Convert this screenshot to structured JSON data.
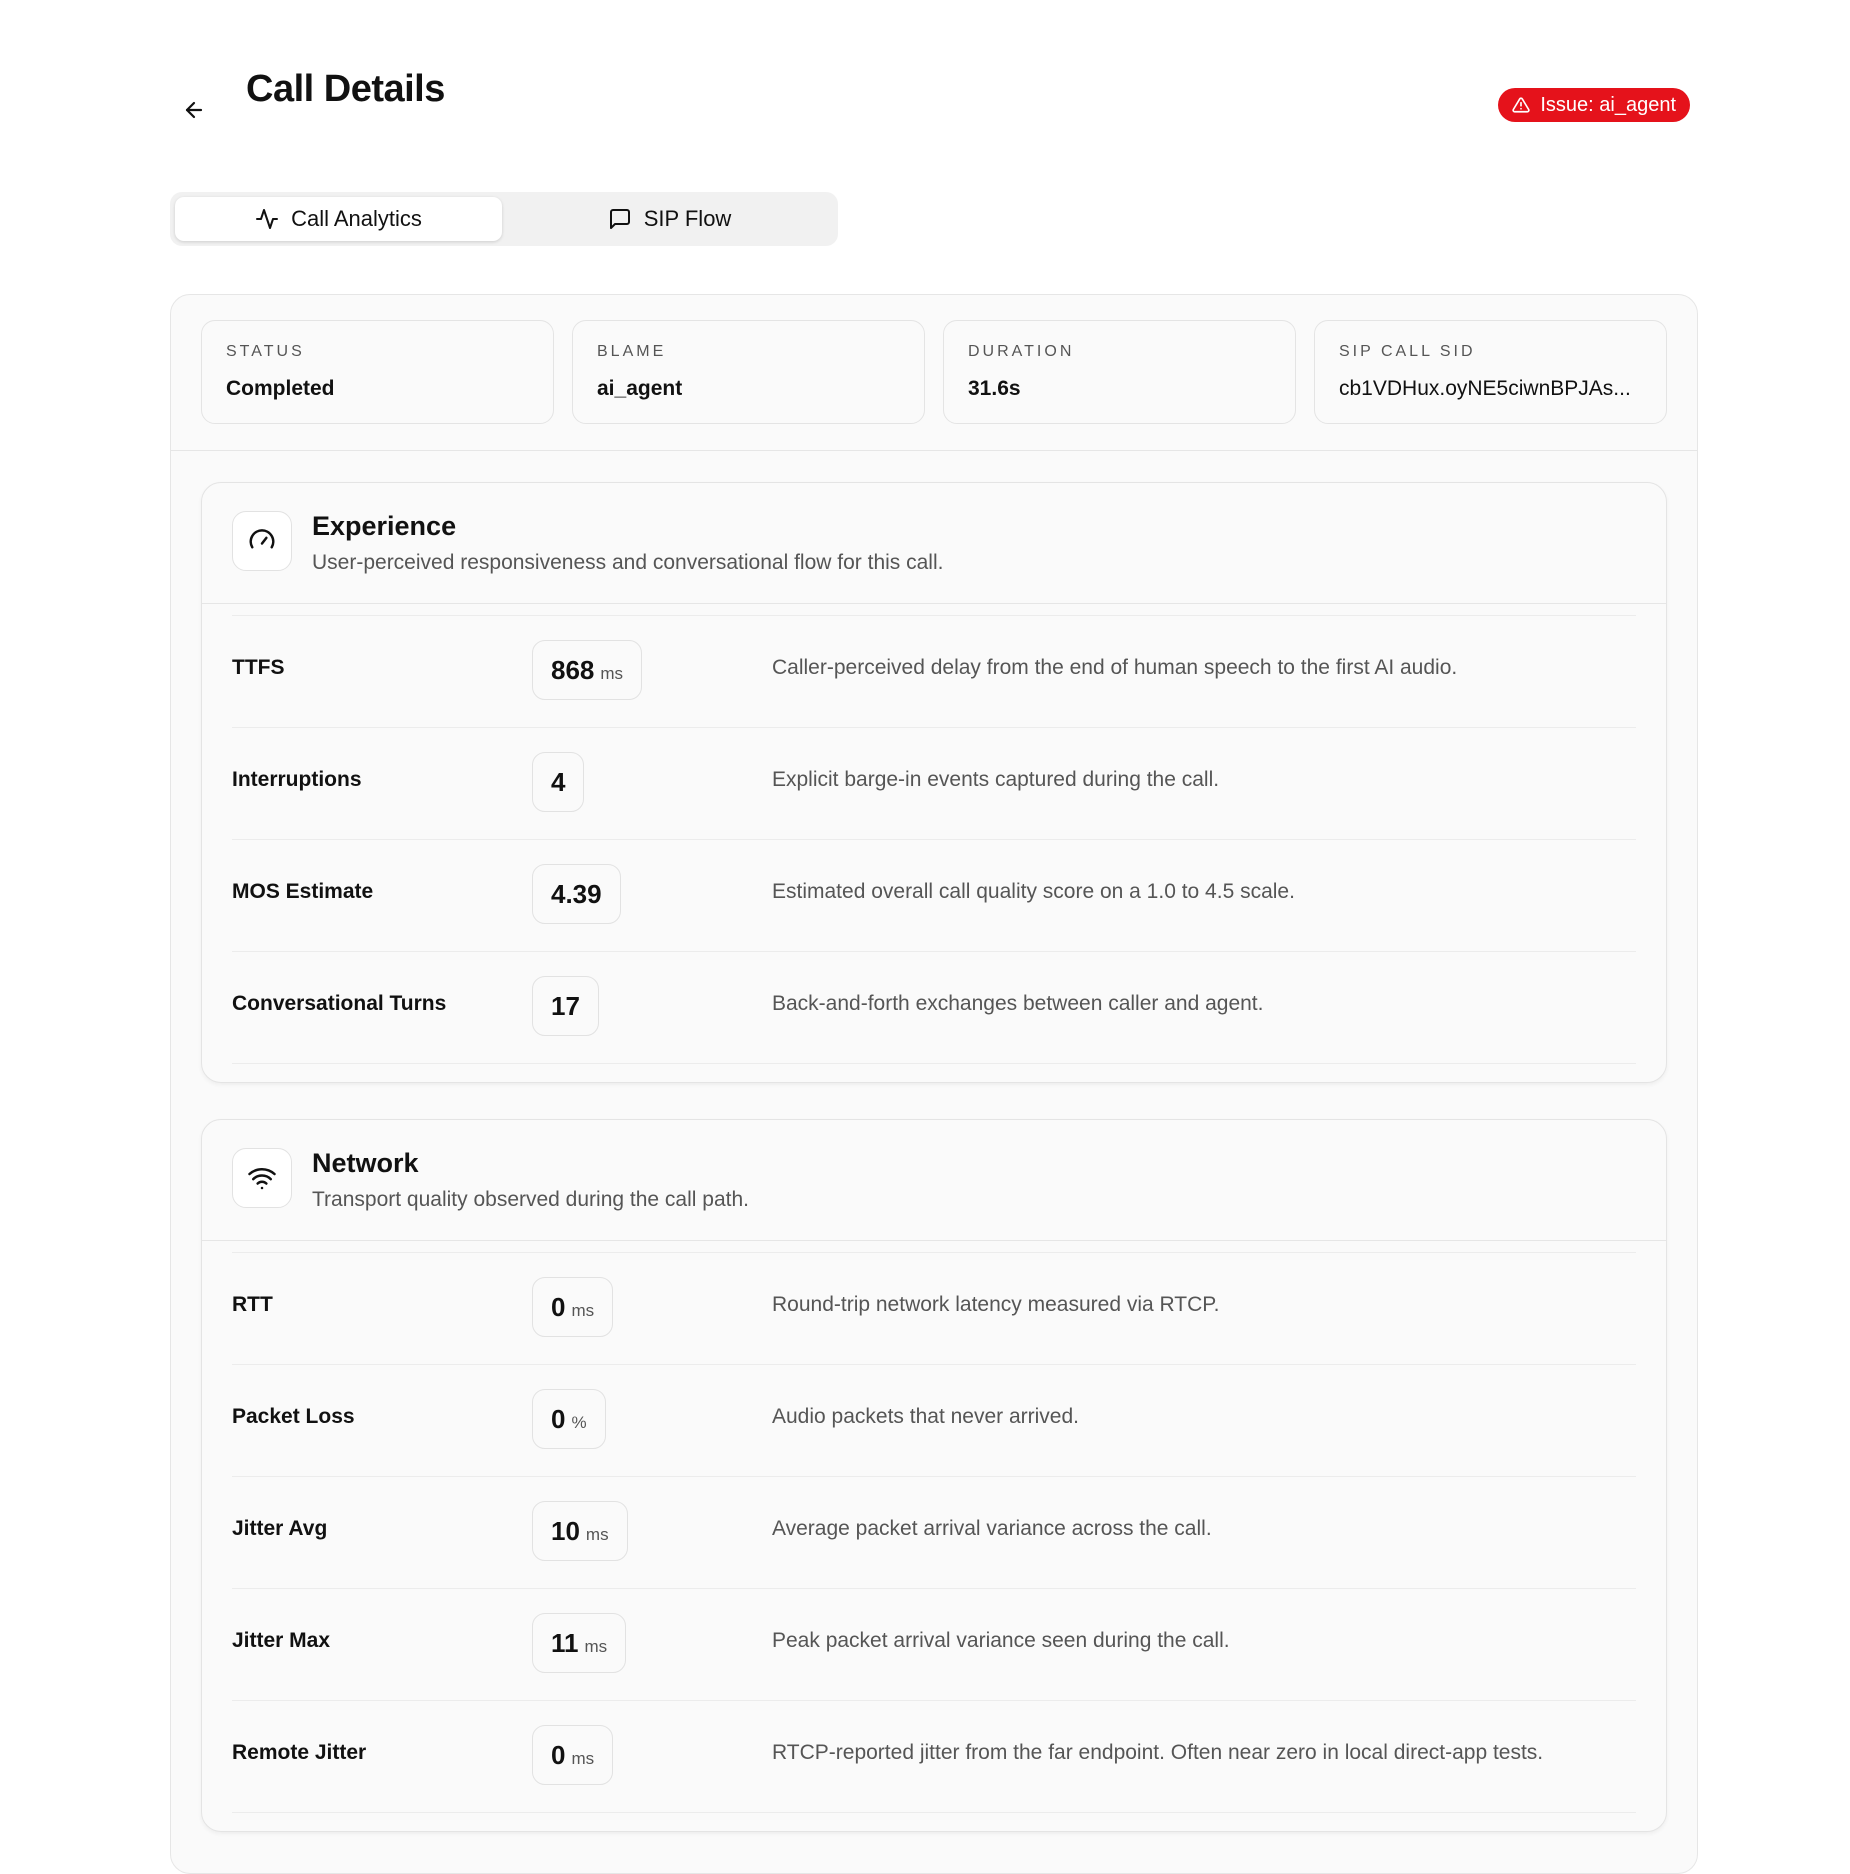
{
  "header": {
    "title": "Call Details",
    "issue_badge": "Issue: ai_agent"
  },
  "tabs": [
    {
      "label": "Call Analytics",
      "active": true,
      "icon": "activity-icon"
    },
    {
      "label": "SIP Flow",
      "active": false,
      "icon": "message-square-icon"
    }
  ],
  "summary": [
    {
      "label": "STATUS",
      "value": "Completed"
    },
    {
      "label": "BLAME",
      "value": "ai_agent"
    },
    {
      "label": "DURATION",
      "value": "31.6s"
    },
    {
      "label": "SIP CALL SID",
      "value": "cb1VDHux.oyNE5ciwnBPJAs..."
    }
  ],
  "experience": {
    "title": "Experience",
    "subtitle": "User-perceived responsiveness and conversational flow for this call.",
    "icon": "gauge-icon",
    "metrics": [
      {
        "name": "TTFS",
        "value": "868",
        "unit": "ms",
        "desc": "Caller-perceived delay from the end of human speech to the first AI audio."
      },
      {
        "name": "Interruptions",
        "value": "4",
        "unit": "",
        "desc": "Explicit barge-in events captured during the call."
      },
      {
        "name": "MOS Estimate",
        "value": "4.39",
        "unit": "",
        "desc": "Estimated overall call quality score on a 1.0 to 4.5 scale."
      },
      {
        "name": "Conversational Turns",
        "value": "17",
        "unit": "",
        "desc": "Back-and-forth exchanges between caller and agent."
      }
    ]
  },
  "network": {
    "title": "Network",
    "subtitle": "Transport quality observed during the call path.",
    "icon": "wifi-icon",
    "metrics": [
      {
        "name": "RTT",
        "value": "0",
        "unit": "ms",
        "desc": "Round-trip network latency measured via RTCP."
      },
      {
        "name": "Packet Loss",
        "value": "0",
        "unit": "%",
        "desc": "Audio packets that never arrived."
      },
      {
        "name": "Jitter Avg",
        "value": "10",
        "unit": "ms",
        "desc": "Average packet arrival variance across the call."
      },
      {
        "name": "Jitter Max",
        "value": "11",
        "unit": "ms",
        "desc": "Peak packet arrival variance seen during the call."
      },
      {
        "name": "Remote Jitter",
        "value": "0",
        "unit": "ms",
        "desc": "RTCP-reported jitter from the far endpoint. Often near zero in local direct-app tests."
      }
    ]
  },
  "colors": {
    "issue": "#e5121b",
    "panel_bg": "#fafafa",
    "border": "#e4e4e4",
    "muted_text": "#555555"
  }
}
